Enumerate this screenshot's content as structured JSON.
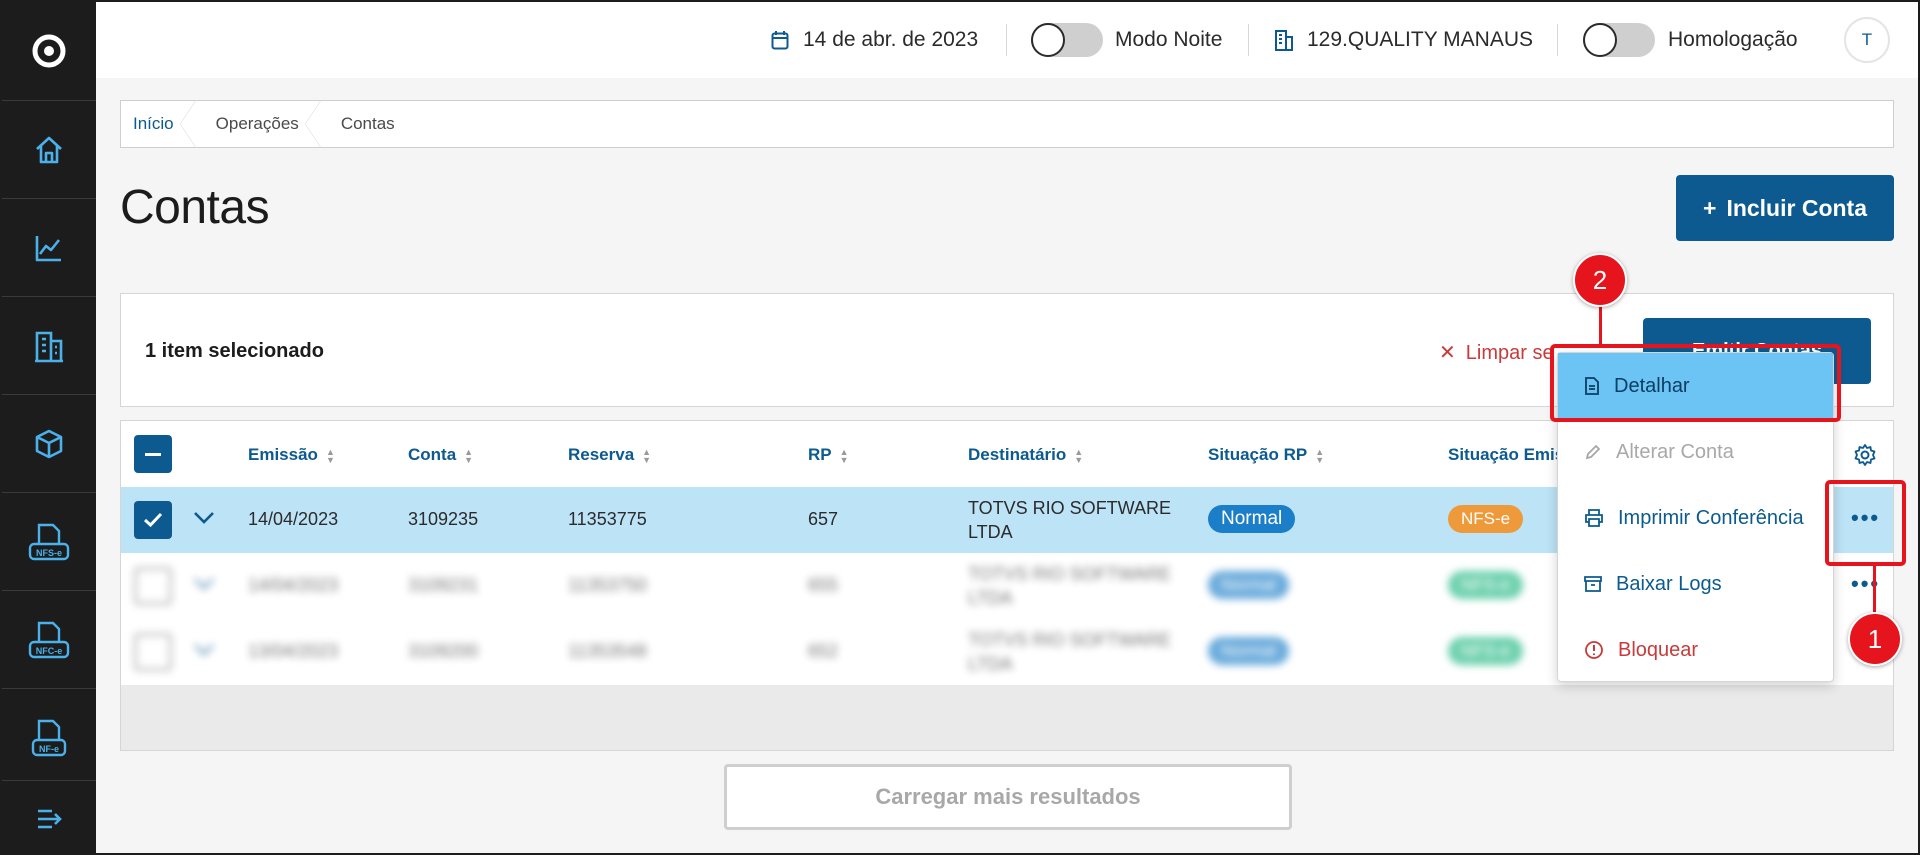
{
  "sidebar": {
    "items": [
      {
        "icon": "app-logo-icon"
      },
      {
        "icon": "home-icon"
      },
      {
        "icon": "chart-icon"
      },
      {
        "icon": "building-icon"
      },
      {
        "icon": "box-icon"
      },
      {
        "icon": "nfs-e-icon",
        "label": "NFS-e"
      },
      {
        "icon": "nfc-e-icon",
        "label": "NFC-e"
      },
      {
        "icon": "nf-e-icon",
        "label": "NF-e"
      },
      {
        "icon": "menu-expand-icon"
      }
    ]
  },
  "topbar": {
    "date": "14 de abr. de 2023",
    "night_mode_label": "Modo Noite",
    "company": "129.QUALITY MANAUS",
    "environment_label": "Homologação",
    "avatar_initial": "T"
  },
  "breadcrumb": [
    "Início",
    "Operações",
    "Contas"
  ],
  "page": {
    "title": "Contas",
    "add_button": "Incluir Conta",
    "add_button_icon": "+"
  },
  "selection": {
    "count_text": "1 item selecionado",
    "clear_label": "Limpar se",
    "emit_label": "Emitir Contas"
  },
  "table": {
    "columns": [
      "Emissão",
      "Conta",
      "Reserva",
      "RP",
      "Destinatário",
      "Situação RP",
      "Situação Emis"
    ],
    "rows": [
      {
        "date": "14/04/2023",
        "conta": "3109235",
        "reserva": "11353775",
        "rp": "657",
        "dest": "TOTVS RIO SOFTWARE LTDA",
        "sit_rp": "Normal",
        "sit_emis": "NFS-e",
        "selected": true
      },
      {
        "date": "14/04/2023",
        "conta": "3109231",
        "reserva": "11353750",
        "rp": "655",
        "dest": "TOTVS RIO SOFTWARE LTDA",
        "sit_rp": "Normal",
        "sit_emis": "NFS-e",
        "selected": false
      },
      {
        "date": "13/04/2023",
        "conta": "3109200",
        "reserva": "11353548",
        "rp": "652",
        "dest": "TOTVS RIO SOFTWARE LTDA",
        "sit_rp": "Normal",
        "sit_emis": "NFS-e",
        "selected": false
      }
    ],
    "load_more": "Carregar mais resultados"
  },
  "menu": {
    "items": [
      {
        "label": "Detalhar",
        "icon": "document-icon",
        "state": "active"
      },
      {
        "label": "Alterar Conta",
        "icon": "pencil-icon",
        "state": "disabled"
      },
      {
        "label": "Imprimir Conferência",
        "icon": "printer-icon",
        "state": "link"
      },
      {
        "label": "Baixar Logs",
        "icon": "archive-icon",
        "state": "link"
      },
      {
        "label": "Bloquear",
        "icon": "alert-icon",
        "state": "danger"
      }
    ]
  },
  "annotations": {
    "step1": "1",
    "step2": "2"
  },
  "colors": {
    "primary": "#0c5a8f",
    "selected_row": "#bde3f7",
    "menu_active": "#6cc4f5",
    "danger": "#c93a3a",
    "badge_normal": "#1a7ec8",
    "badge_nfse": "#ef9a3a",
    "annotation": "#e6141d"
  }
}
